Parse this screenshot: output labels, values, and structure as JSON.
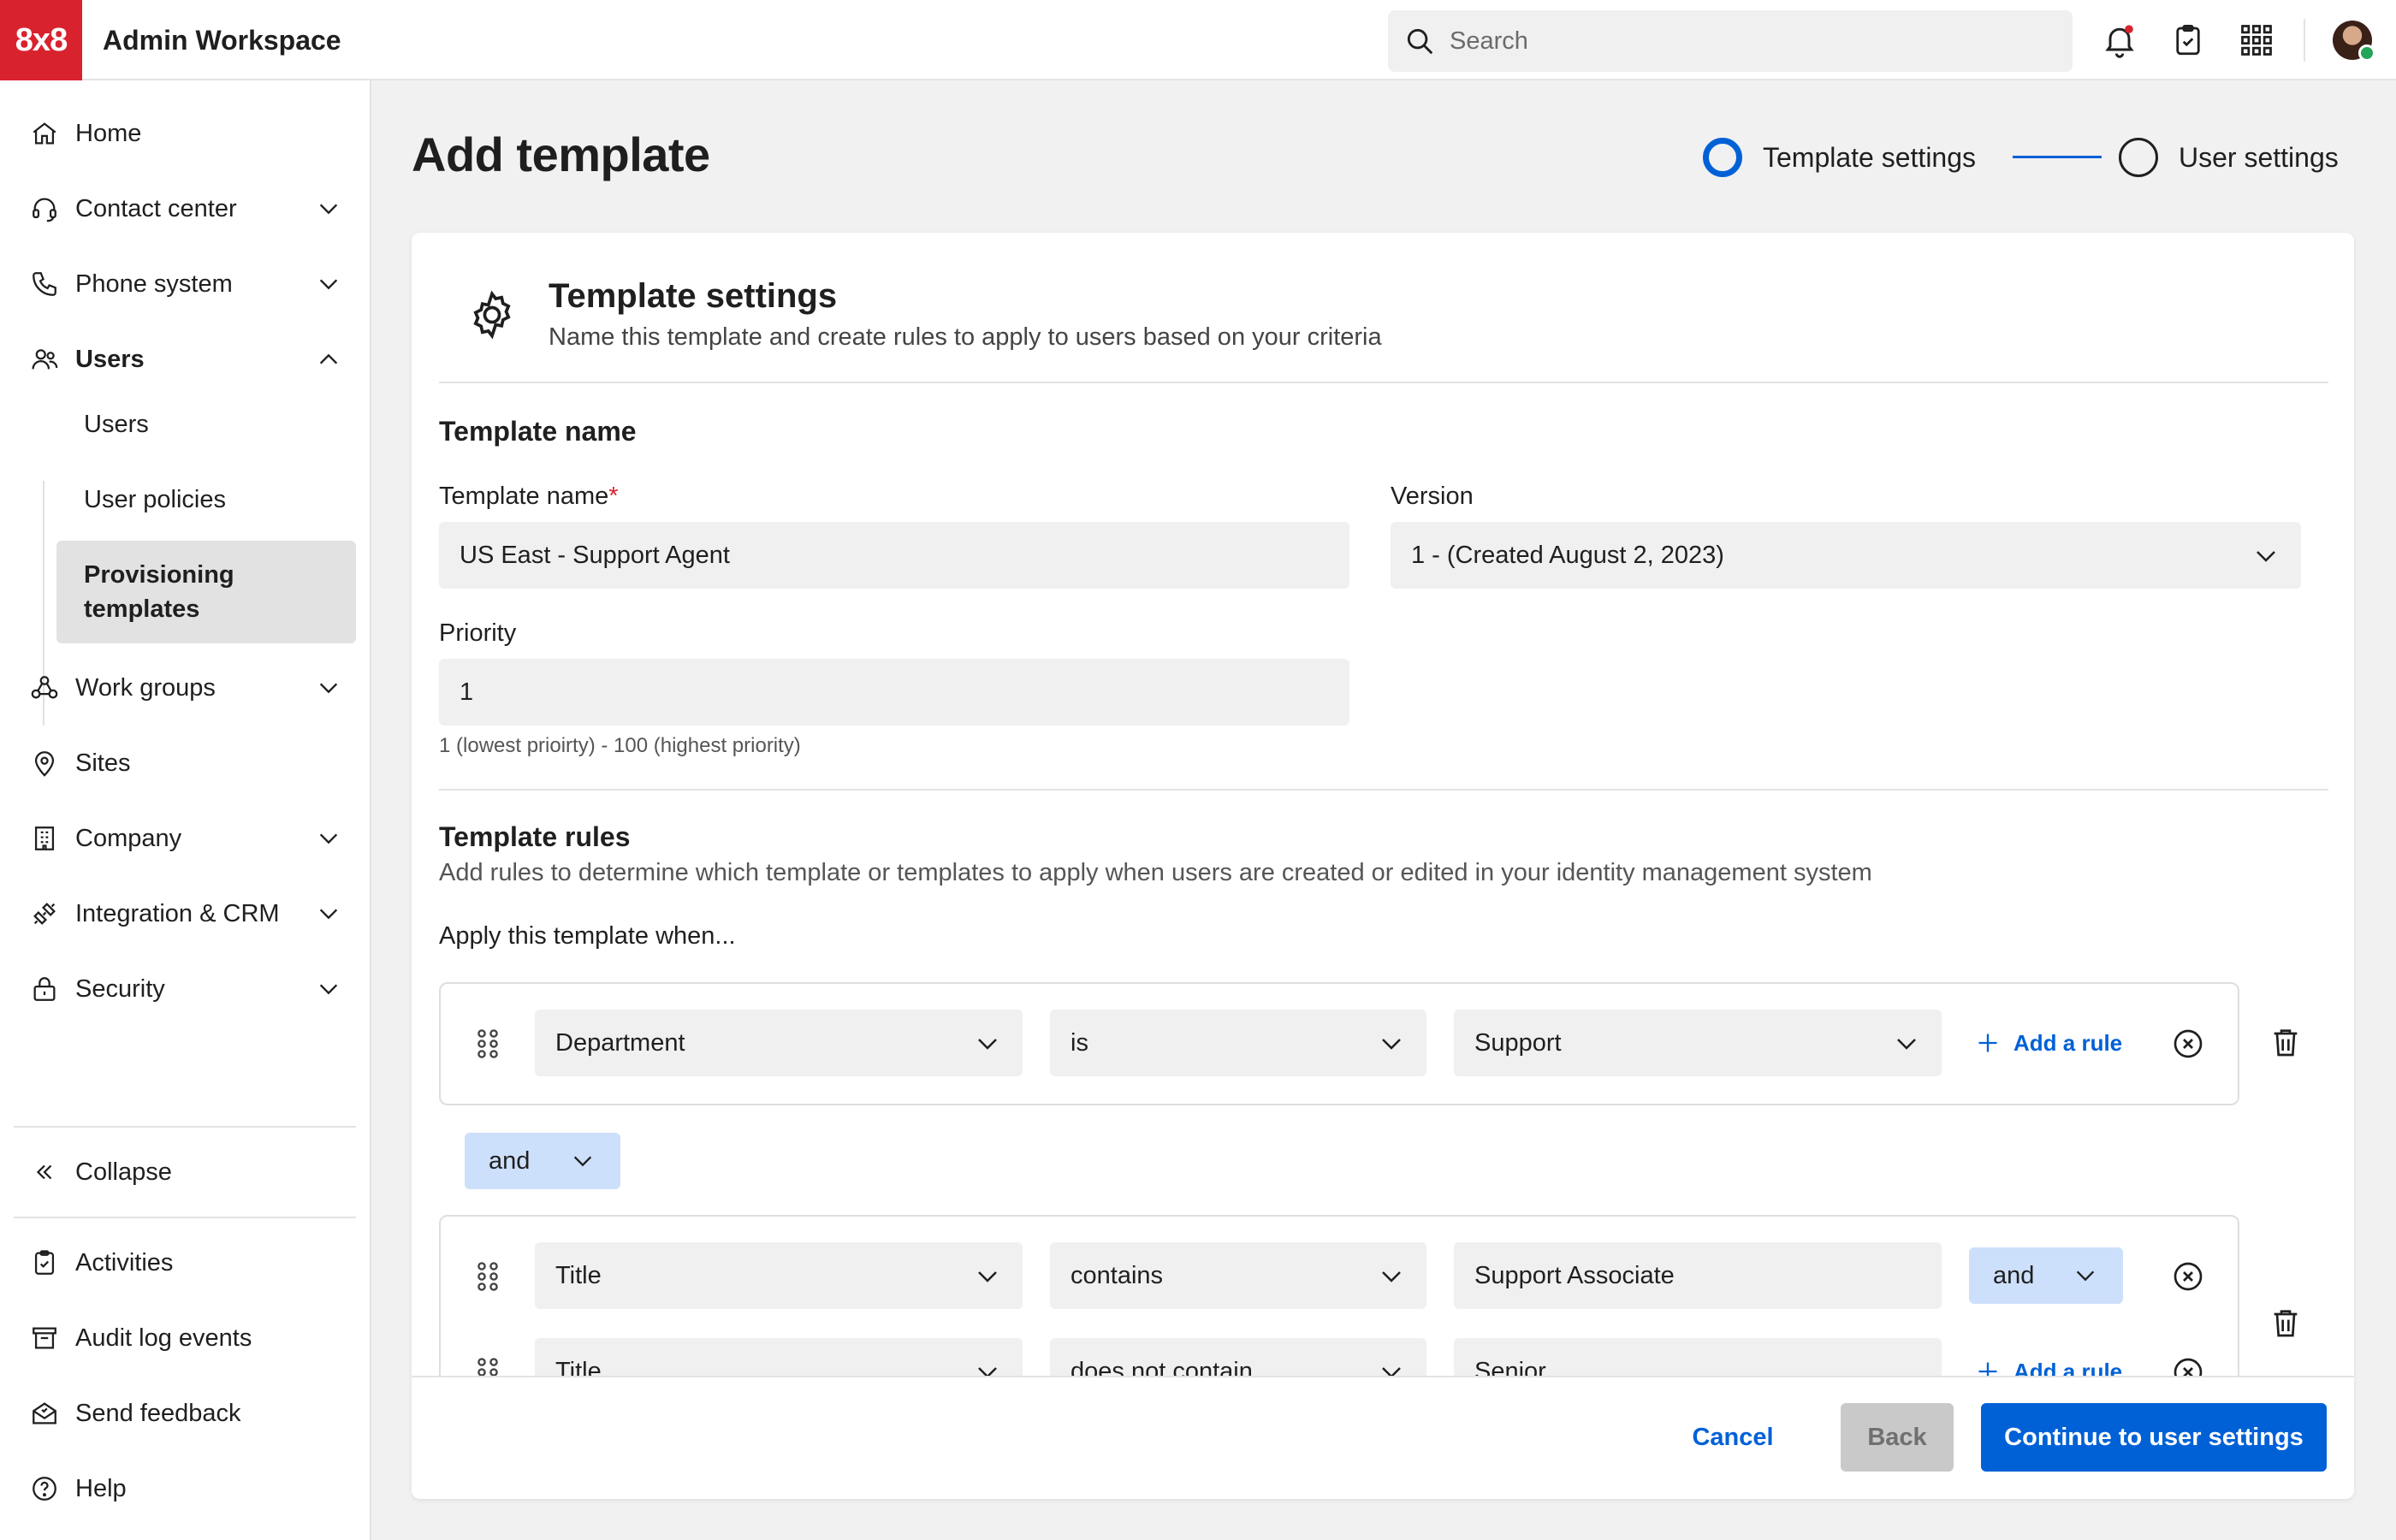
{
  "header": {
    "logo": "8x8",
    "app_title": "Admin Workspace",
    "search_placeholder": "Search"
  },
  "sidebar": {
    "items": [
      {
        "label": "Home",
        "icon": "home-icon"
      },
      {
        "label": "Contact center",
        "icon": "headset-icon"
      },
      {
        "label": "Phone system",
        "icon": "phone-icon"
      },
      {
        "label": "Users",
        "icon": "users-icon"
      },
      {
        "label": "Work groups",
        "icon": "work-groups-icon"
      },
      {
        "label": "Sites",
        "icon": "map-pin-icon"
      },
      {
        "label": "Company",
        "icon": "building-icon"
      },
      {
        "label": "Integration & CRM",
        "icon": "integration-icon"
      },
      {
        "label": "Security",
        "icon": "lock-icon"
      }
    ],
    "users_sub": [
      "Users",
      "User policies",
      "Provisioning templates"
    ],
    "bottom": [
      {
        "label": "Collapse",
        "icon": "double-chevron-left-icon"
      },
      {
        "label": "Activities",
        "icon": "clipboard-check-icon"
      },
      {
        "label": "Audit log events",
        "icon": "archive-icon"
      },
      {
        "label": "Send feedback",
        "icon": "feedback-icon"
      },
      {
        "label": "Help",
        "icon": "help-icon"
      }
    ]
  },
  "page": {
    "title": "Add template",
    "steps": [
      "Template settings",
      "User settings"
    ],
    "active_step": 0
  },
  "card": {
    "title": "Template settings",
    "subtitle": "Name this template and create rules to apply to users based on your criteria",
    "name_section": "Template name",
    "name_label": "Template name",
    "name_required_mark": "*",
    "name_value": "US East - Support Agent",
    "version_label": "Version",
    "version_value": "1 - (Created August 2, 2023)",
    "priority_label": "Priority",
    "priority_value": "1",
    "priority_help": "1 (lowest prioirty) - 100 (highest priority)",
    "rules_title": "Template rules",
    "rules_desc": "Add rules to determine which template or templates to apply when users are created or edited in your identity management system",
    "apply_when": "Apply this template when...",
    "add_rule": "Add a rule",
    "connector": "and",
    "groups": [
      {
        "rules": [
          {
            "field": "Department",
            "operator": "is",
            "value": "Support"
          }
        ]
      },
      {
        "rules": [
          {
            "field": "Title",
            "operator": "contains",
            "value": "Support Associate",
            "joiner": "and"
          },
          {
            "field": "Title",
            "operator": "does not contain",
            "value": "Senior"
          }
        ]
      }
    ]
  },
  "footer": {
    "cancel": "Cancel",
    "back": "Back",
    "continue": "Continue to user settings"
  },
  "colors": {
    "brand_red": "#d8232f",
    "accent_blue": "#0061d6",
    "pill_blue": "#cde0fb",
    "field_bg": "#f0f0f0"
  }
}
